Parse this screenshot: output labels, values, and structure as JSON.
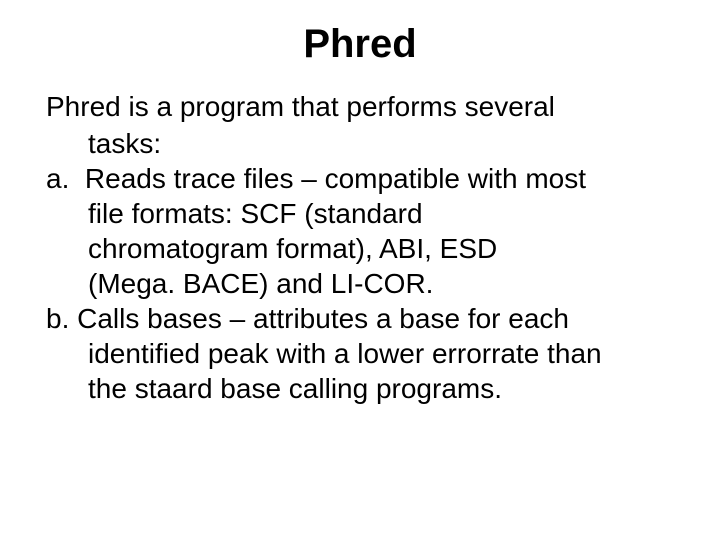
{
  "title": "Phred",
  "intro_line1": "Phred is a program that performs several",
  "intro_line2": "tasks:",
  "a_line1": "a.  Reads trace files – compatible with most",
  "a_line2": "file formats: SCF (standard",
  "a_line3": "chromatogram format), ABI, ESD",
  "a_line4": "(Mega. BACE) and LI-COR.",
  "b_line1": "b. Calls bases – attributes a base for each",
  "b_line2": "identified peak with a lower errorrate than",
  "b_line3": "the staard base calling programs."
}
